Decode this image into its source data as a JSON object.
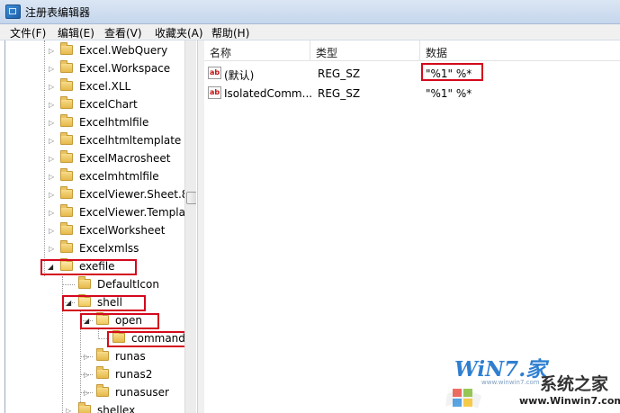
{
  "window": {
    "title": "注册表编辑器"
  },
  "menu": [
    "文件(F)",
    "编辑(E)",
    "查看(V)",
    "收藏夹(A)",
    "帮助(H)"
  ],
  "tree": {
    "items": [
      {
        "label": "Excel.WebQuery"
      },
      {
        "label": "Excel.Workspace"
      },
      {
        "label": "Excel.XLL"
      },
      {
        "label": "ExcelChart"
      },
      {
        "label": "Excelhtmlfile"
      },
      {
        "label": "Excelhtmltemplate"
      },
      {
        "label": "ExcelMacrosheet"
      },
      {
        "label": "excelmhtmlfile"
      },
      {
        "label": "ExcelViewer.Sheet.8"
      },
      {
        "label": "ExcelViewer.Templa"
      },
      {
        "label": "ExcelWorksheet"
      },
      {
        "label": "Excelxmlss"
      },
      {
        "label": "exefile"
      },
      {
        "label": "DefaultIcon"
      },
      {
        "label": "shell"
      },
      {
        "label": "open"
      },
      {
        "label": "command"
      },
      {
        "label": "runas"
      },
      {
        "label": "runas2"
      },
      {
        "label": "runasuser"
      },
      {
        "label": "shellex"
      }
    ]
  },
  "list": {
    "headers": {
      "name": "名称",
      "type": "类型",
      "data": "数据"
    },
    "rows": [
      {
        "name": "(默认)",
        "type": "REG_SZ",
        "data": "\"%1\" %*",
        "icon": "ab-string-icon"
      },
      {
        "name": "IsolatedComm...",
        "type": "REG_SZ",
        "data": "\"%1\" %*",
        "icon": "ab-string-icon"
      }
    ]
  },
  "watermark": {
    "brand": "WiN7.家",
    "site_cn": "系统之家",
    "url": "www.Winwin7.com",
    "small": "www.winwin7.com"
  },
  "colors": {
    "highlight_box": "#d4091c",
    "folder": "#e6b94a",
    "titlebar": "#c5d6ec"
  }
}
